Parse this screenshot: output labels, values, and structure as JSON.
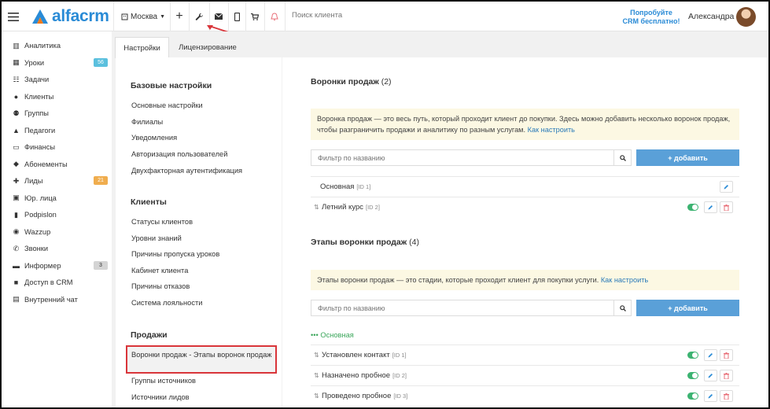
{
  "topbar": {
    "logo": "alfacrm",
    "city": "Москва",
    "search_placeholder": "Поиск клиента",
    "try_line1": "Попробуйте",
    "try_line2": "CRM бесплатно!",
    "user": "Александра",
    "icons": [
      "menu-icon",
      "plus-icon",
      "wrench-icon",
      "mail-icon",
      "phone-icon",
      "cart-icon",
      "bell-icon"
    ]
  },
  "sidebar": {
    "items": [
      {
        "label": "Аналитика",
        "icon": "analytics-icon",
        "badge": ""
      },
      {
        "label": "Уроки",
        "icon": "calendar-icon",
        "badge": "56"
      },
      {
        "label": "Задачи",
        "icon": "tasks-icon",
        "badge": ""
      },
      {
        "label": "Клиенты",
        "icon": "user-icon",
        "badge": ""
      },
      {
        "label": "Группы",
        "icon": "users-icon",
        "badge": ""
      },
      {
        "label": "Педагоги",
        "icon": "graduation-cap-icon",
        "badge": ""
      },
      {
        "label": "Финансы",
        "icon": "money-icon",
        "badge": ""
      },
      {
        "label": "Абонементы",
        "icon": "tag-icon",
        "badge": ""
      },
      {
        "label": "Лиды",
        "icon": "user-plus-icon",
        "badge": "21"
      },
      {
        "label": "Юр. лица",
        "icon": "building-icon",
        "badge": ""
      },
      {
        "label": "Podpislon",
        "icon": "document-icon",
        "badge": ""
      },
      {
        "label": "Wazzup",
        "icon": "whatsapp-icon",
        "badge": ""
      },
      {
        "label": "Звонки",
        "icon": "phone-call-icon",
        "badge": ""
      },
      {
        "label": "Информер",
        "icon": "comment-icon",
        "badge": "3"
      },
      {
        "label": "Доступ в CRM",
        "icon": "lock-icon",
        "badge": ""
      },
      {
        "label": "Внутренний чат",
        "icon": "chat-icon",
        "badge": ""
      }
    ]
  },
  "tabs": {
    "settings": "Настройки",
    "licensing": "Лицензирование"
  },
  "settings_nav": {
    "basic_title": "Базовые настройки",
    "basic": [
      "Основные настройки",
      "Филиалы",
      "Уведомления",
      "Авторизация пользователей",
      "Двухфакторная аутентификация"
    ],
    "clients_title": "Клиенты",
    "clients": [
      "Статусы клиентов",
      "Уровни знаний",
      "Причины пропуска уроков",
      "Кабинет клиента",
      "Причины отказов",
      "Система лояльности"
    ],
    "sales_title": "Продажи",
    "sales_active": "Воронки продаж - Этапы воронок продаж",
    "sales": [
      "Группы источников",
      "Источники лидов"
    ]
  },
  "funnels": {
    "title": "Воронки продаж",
    "count": "(2)",
    "info": "Воронка продаж — это весь путь, который проходит клиент до покупки. Здесь можно добавить несколько воронок продаж, чтобы разграничить продажи и аналитику по разным услугам.",
    "info_link": "Как настроить",
    "filter_placeholder": "Фильтр по названию",
    "add": "+ добавить",
    "rows": [
      {
        "name": "Основная",
        "id": "[ID 1]"
      },
      {
        "name": "Летний курс",
        "id": "[ID 2]"
      }
    ]
  },
  "stages": {
    "title": "Этапы воронки продаж",
    "count": "(4)",
    "info": "Этапы воронки продаж — это стадии, которые проходит клиент для покупки услуги.",
    "info_link": "Как настроить",
    "filter_placeholder": "Фильтр по названию",
    "add": "+ добавить",
    "group": "••• Основная",
    "rows": [
      {
        "name": "Установлен контакт",
        "id": "[ID 1]"
      },
      {
        "name": "Назначено пробное",
        "id": "[ID 2]"
      },
      {
        "name": "Проведено пробное",
        "id": "[ID 3]"
      }
    ]
  },
  "colors": {
    "accent": "#2a8bd6",
    "add_button": "#5aa0d8",
    "toggle": "#3cb371",
    "highlight": "#d9353a",
    "info_bg": "#fcf8e3"
  }
}
